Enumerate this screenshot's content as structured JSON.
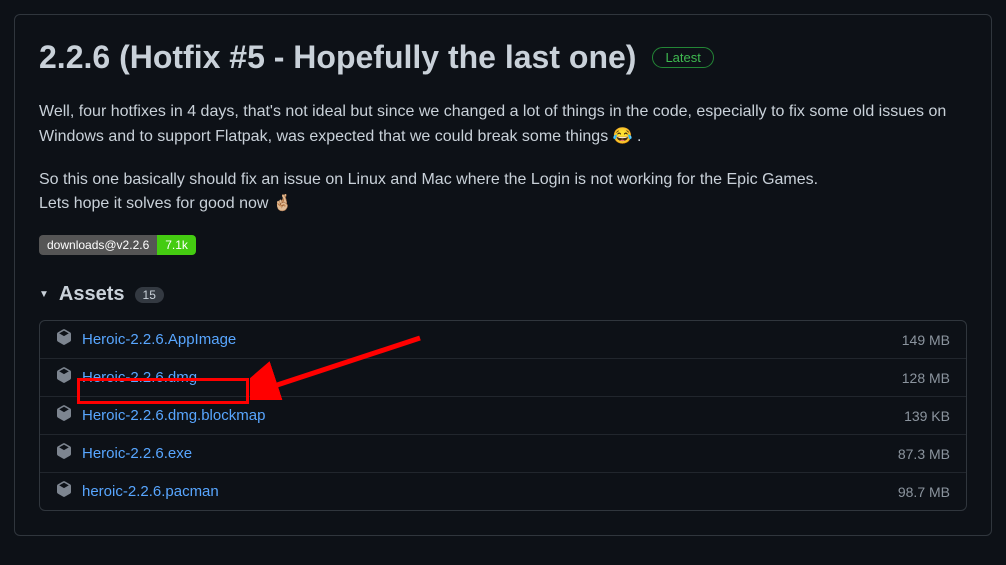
{
  "release": {
    "title": "2.2.6 (Hotfix #5 - Hopefully the last one)",
    "latest_label": "Latest",
    "body_p1_a": "Well, four hotfixes in 4 days, that's not ideal but since we changed a lot of things in the code, especially to fix some old issues on Windows and to support Flatpak, was expected that we could break some things ",
    "body_p1_b": " .",
    "body_p2_a": "So this one basically should fix an issue on Linux and Mac where the Login is not working for the Epic Games.",
    "body_p2_b": "Lets hope it solves for good now 🤞🏼",
    "downloads_badge_left": "downloads@v2.2.6",
    "downloads_badge_right": "7.1k"
  },
  "assets": {
    "heading": "Assets",
    "count": "15",
    "items": [
      {
        "name": "Heroic-2.2.6.AppImage",
        "size": "149 MB"
      },
      {
        "name": "Heroic-2.2.6.dmg",
        "size": "128 MB"
      },
      {
        "name": "Heroic-2.2.6.dmg.blockmap",
        "size": "139 KB"
      },
      {
        "name": "Heroic-2.2.6.exe",
        "size": "87.3 MB"
      },
      {
        "name": "heroic-2.2.6.pacman",
        "size": "98.7 MB"
      }
    ]
  }
}
